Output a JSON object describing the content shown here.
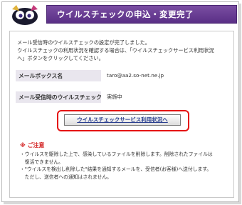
{
  "header": {
    "title": "ウイルスチェックの申込・変更完了"
  },
  "intro": {
    "line1": "メール受信時のウイルスチェックの設定が完了しました。",
    "line2": "ウイルスチェックの利用状況を確認する場合は、「ウイルスチェックサービス利用状況",
    "line3": "へ」ボタンをクリックしてください。"
  },
  "mailbox": {
    "label": "メールボックス名",
    "value": "taro@aa2.so-net.ne.jp"
  },
  "viruscheck": {
    "label": "メール受信時のウイルスチェック",
    "value": "実施中"
  },
  "status_button": {
    "label": "ウイルスチェックサービス利用状況へ"
  },
  "caution": {
    "title": "※ ご注意",
    "notes": [
      "・ウイルスを駆除した上で、感染しているファイルを削除します。削除されたファイルは",
      "　復活できません。",
      "・\"ウイルスを検出し削除した\"結果を通知するメールを、受信者(お客様)へ送付します。",
      "　ただし、送信者への通知はされません。"
    ]
  },
  "colors": {
    "title_bar": "#5a2f86",
    "highlight": "#e51414",
    "caution": "#d21f1f",
    "label_bg": "#e9e6ee"
  }
}
